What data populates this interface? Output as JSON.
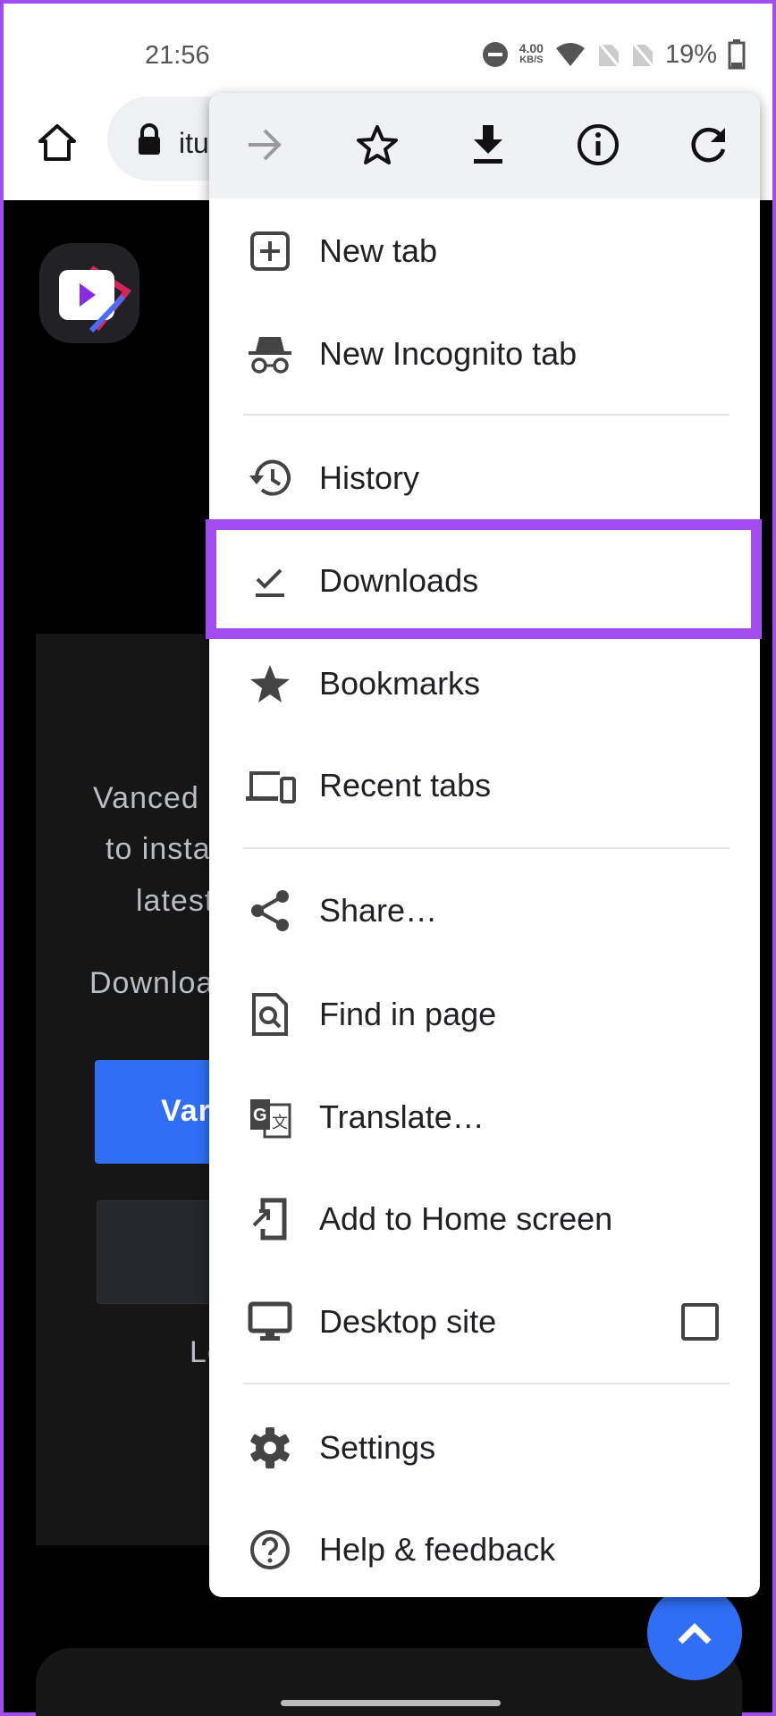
{
  "status_bar": {
    "time": "21:56",
    "speed_value": "4.00",
    "speed_unit": "KB/S",
    "battery": "19%"
  },
  "toolbar": {
    "url_partial": "itu"
  },
  "page": {
    "text_lines": [
      "Vanced",
      "to insta",
      "latest",
      "Downloa"
    ],
    "primary_button": "Var",
    "footer_partial": "Lo"
  },
  "menu": {
    "toolbar_icons": [
      "forward-icon",
      "bookmark-star-icon",
      "download-icon",
      "info-icon",
      "refresh-icon"
    ],
    "items": [
      {
        "label": "New tab",
        "icon": "new-tab-icon"
      },
      {
        "label": "New Incognito tab",
        "icon": "incognito-icon"
      },
      {
        "label": "History",
        "icon": "history-icon"
      },
      {
        "label": "Downloads",
        "icon": "downloads-icon",
        "highlighted": true
      },
      {
        "label": "Bookmarks",
        "icon": "star-icon"
      },
      {
        "label": "Recent tabs",
        "icon": "devices-icon"
      },
      {
        "label": "Share…",
        "icon": "share-icon"
      },
      {
        "label": "Find in page",
        "icon": "find-icon"
      },
      {
        "label": "Translate…",
        "icon": "translate-icon"
      },
      {
        "label": "Add to Home screen",
        "icon": "add-home-icon"
      },
      {
        "label": "Desktop site",
        "icon": "desktop-icon",
        "checked": false
      },
      {
        "label": "Settings",
        "icon": "settings-icon"
      },
      {
        "label": "Help & feedback",
        "icon": "help-icon"
      }
    ]
  },
  "colors": {
    "highlight": "#a24cf0",
    "accent_blue": "#2f6ef5"
  }
}
